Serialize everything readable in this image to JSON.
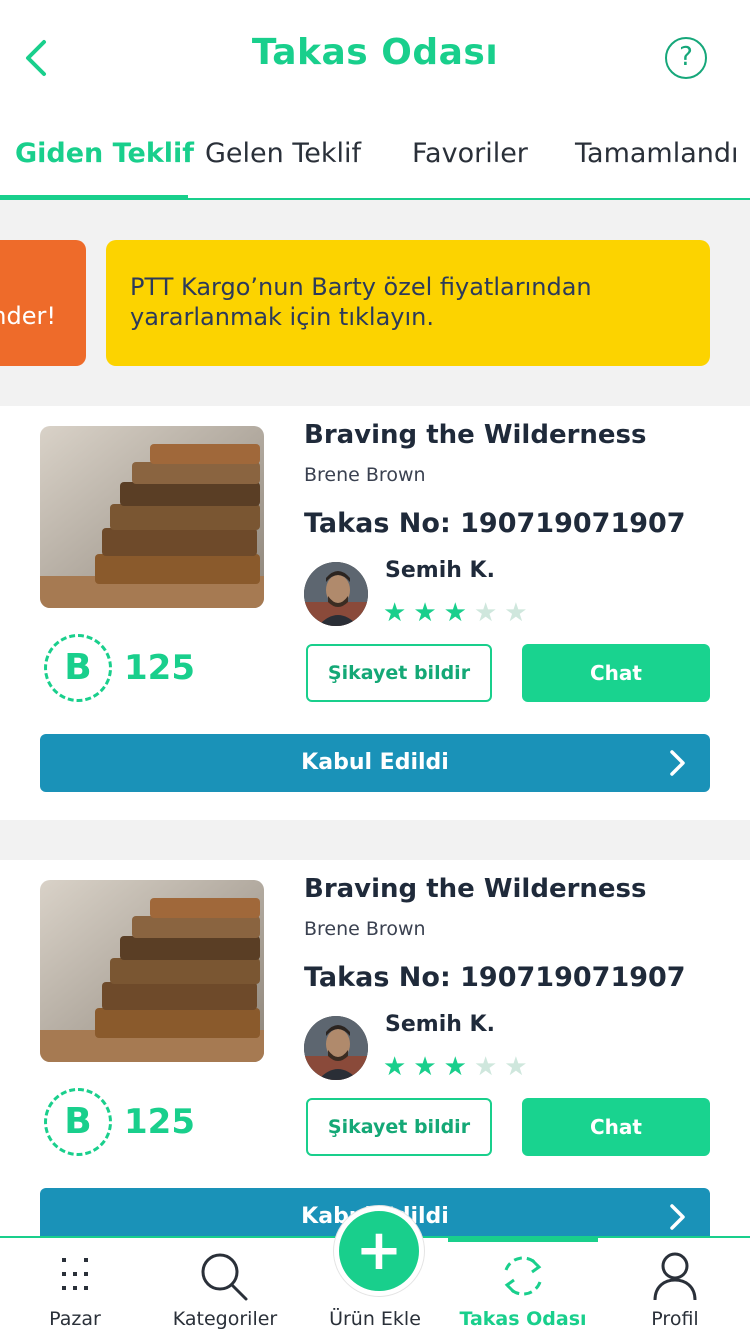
{
  "header": {
    "title": "Takas Odası",
    "help_symbol": "?"
  },
  "tabs": [
    {
      "label": "Giden Teklif",
      "active": true
    },
    {
      "label": "Gelen Teklif",
      "active": false
    },
    {
      "label": "Favoriler",
      "active": false
    },
    {
      "label": "Tamamlandı",
      "active": false
    }
  ],
  "banners": {
    "orange_text": "nder!",
    "yellow_text": "PTT Kargo’nun Barty özel fiyatlarından yararlanmak için tıklayın."
  },
  "offers": [
    {
      "title": "Braving the Wilderness",
      "author": "Brene Brown",
      "trade_no": "Takas No: 190719071907",
      "user": "Semih K.",
      "rating": 3,
      "rating_max": 5,
      "coin_symbol": "B",
      "price": "125",
      "complain_label": "Şikayet bildir",
      "chat_label": "Chat",
      "status_label": "Kabul Edildi"
    },
    {
      "title": "Braving the Wilderness",
      "author": "Brene Brown",
      "trade_no": "Takas No: 190719071907",
      "user": "Semih K.",
      "rating": 3,
      "rating_max": 5,
      "coin_symbol": "B",
      "price": "125",
      "complain_label": "Şikayet bildir",
      "chat_label": "Chat",
      "status_label": "Kabul Edildi"
    }
  ],
  "bottom_nav": {
    "items": [
      {
        "label": "Pazar",
        "icon": "grid-dots-icon"
      },
      {
        "label": "Kategoriler",
        "icon": "search-icon"
      },
      {
        "label": "Ürün Ekle",
        "icon": "plus-icon"
      },
      {
        "label": "Takas Odası",
        "icon": "swap-icon",
        "active": true
      },
      {
        "label": "Profil",
        "icon": "user-icon"
      }
    ]
  },
  "colors": {
    "accent": "#19cf8c",
    "banner_orange": "#ee6b2a",
    "banner_yellow": "#fcd300",
    "accept_blue": "#1a92b8"
  }
}
